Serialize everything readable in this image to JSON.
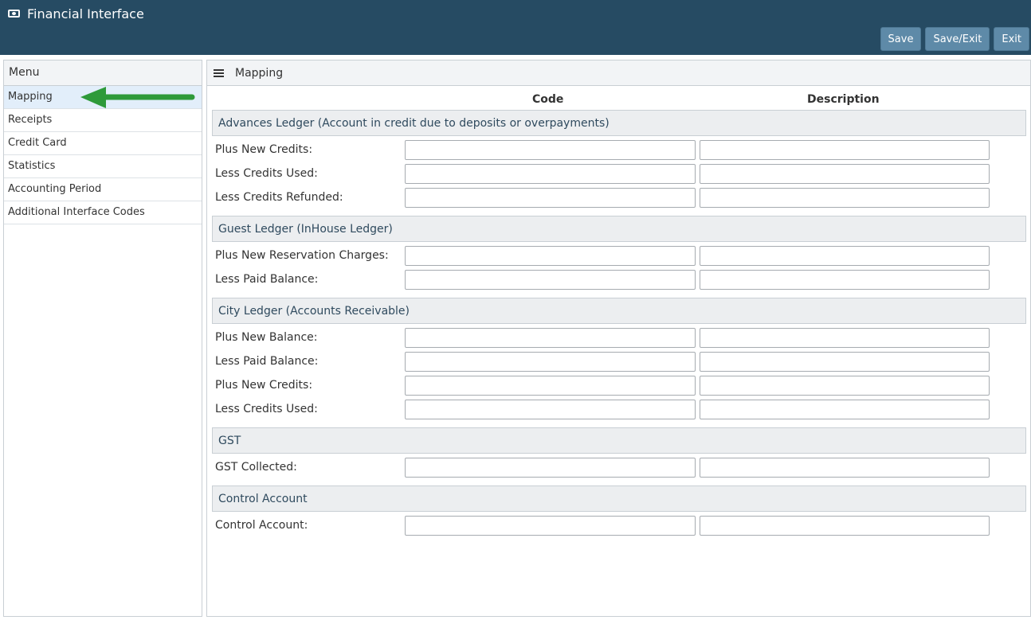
{
  "header": {
    "title": "Financial Interface",
    "icon": "money-bill-icon",
    "buttons": {
      "save": "Save",
      "save_exit": "Save/Exit",
      "exit": "Exit"
    }
  },
  "sidebar": {
    "title": "Menu",
    "items": [
      {
        "label": "Mapping",
        "active": true
      },
      {
        "label": "Receipts"
      },
      {
        "label": "Credit Card"
      },
      {
        "label": "Statistics"
      },
      {
        "label": "Accounting Period"
      },
      {
        "label": "Additional Interface Codes"
      }
    ]
  },
  "main": {
    "title": "Mapping",
    "columns": {
      "code": "Code",
      "description": "Description"
    },
    "sections": [
      {
        "title": "Advances Ledger (Account in credit due to deposits or overpayments)",
        "rows": [
          {
            "label": "Plus New Credits:",
            "code": "",
            "description": ""
          },
          {
            "label": "Less Credits Used:",
            "code": "",
            "description": ""
          },
          {
            "label": "Less Credits Refunded:",
            "code": "",
            "description": ""
          }
        ]
      },
      {
        "title": "Guest Ledger (InHouse Ledger)",
        "rows": [
          {
            "label": "Plus New Reservation Charges:",
            "code": "",
            "description": ""
          },
          {
            "label": "Less Paid Balance:",
            "code": "",
            "description": ""
          }
        ]
      },
      {
        "title": "City Ledger (Accounts Receivable)",
        "rows": [
          {
            "label": "Plus New Balance:",
            "code": "",
            "description": ""
          },
          {
            "label": "Less Paid Balance:",
            "code": "",
            "description": ""
          },
          {
            "label": "Plus New Credits:",
            "code": "",
            "description": ""
          },
          {
            "label": "Less Credits Used:",
            "code": "",
            "description": ""
          }
        ]
      },
      {
        "title": "GST",
        "rows": [
          {
            "label": "GST Collected:",
            "code": "",
            "description": ""
          }
        ]
      },
      {
        "title": "Control Account",
        "rows": [
          {
            "label": "Control Account:",
            "code": "",
            "description": ""
          }
        ]
      }
    ]
  },
  "colors": {
    "header_bg": "#264b63",
    "button_bg": "#5e8aa8",
    "active_menu_bg": "#e2eefa",
    "arrow": "#2e9a3a"
  }
}
